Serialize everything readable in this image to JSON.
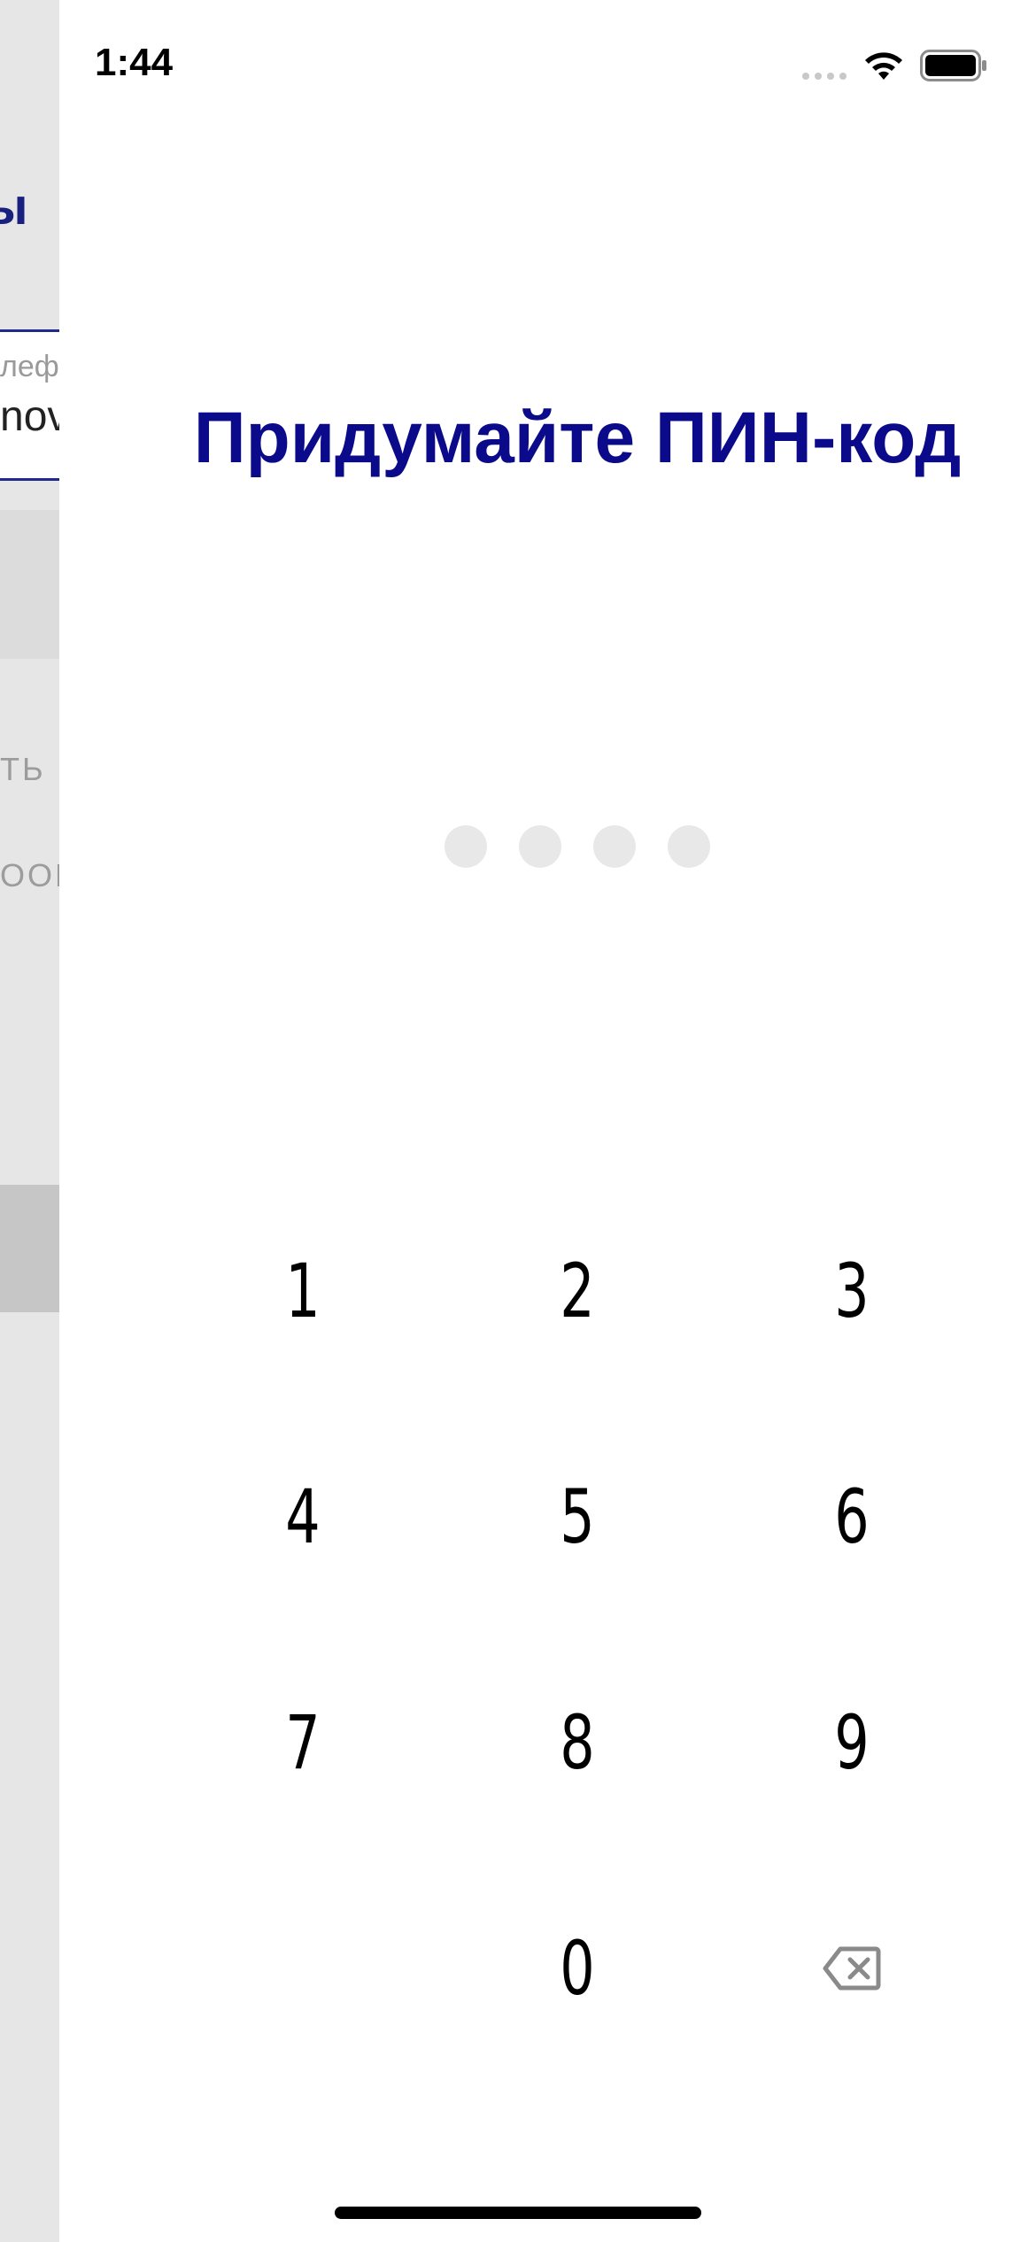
{
  "status_bar": {
    "time": "1:44"
  },
  "background_screen": {
    "heading_fragment": "ы",
    "field_label_fragment": "лефо",
    "field_value_fragment": "nov",
    "link_1_fragment": "ТЬ П",
    "link_2_fragment": "ООБ"
  },
  "pin_screen": {
    "title": "Придумайте ПИН-код",
    "pin_length": 4,
    "entered_digits": 0,
    "keys": {
      "k1": "1",
      "k2": "2",
      "k3": "3",
      "k4": "4",
      "k5": "5",
      "k6": "6",
      "k7": "7",
      "k8": "8",
      "k9": "9",
      "k0": "0"
    },
    "delete_icon": "backspace-icon"
  },
  "colors": {
    "title": "#0a0a8a",
    "pin_dot_empty": "#e8e8e8",
    "background_screen": "#e6e6e6",
    "field_border": "#1f2a8a"
  }
}
